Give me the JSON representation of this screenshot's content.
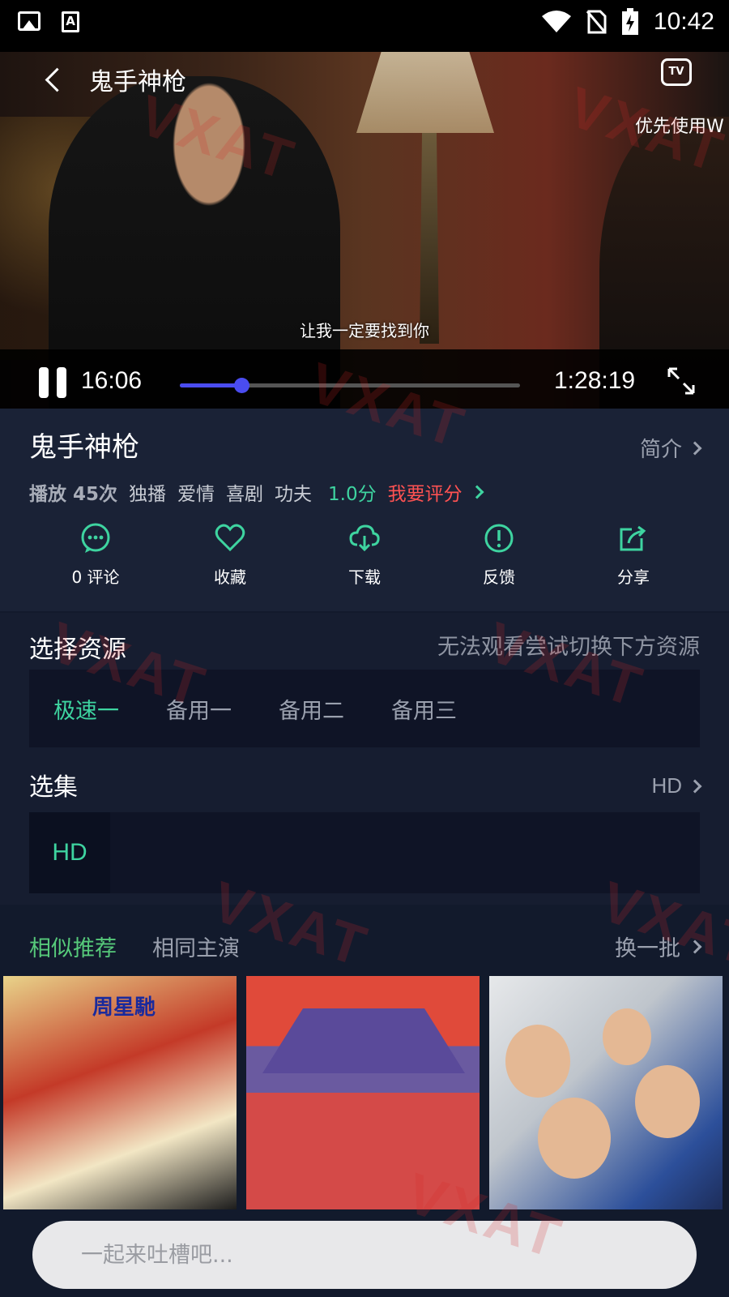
{
  "status_bar": {
    "time": "10:42"
  },
  "player": {
    "title": "鬼手神枪",
    "tv_hint": "优先使用W",
    "subtitle": "让我一定要找到你",
    "current_time": "16:06",
    "total_time": "1:28:19",
    "progress": 0.18
  },
  "info": {
    "title": "鬼手神枪",
    "intro_label": "简介",
    "play_count": "播放 45次",
    "tags": [
      "独播",
      "爱情",
      "喜剧",
      "功夫"
    ],
    "score": "1.0分",
    "rate_label": "我要评分",
    "actions": [
      {
        "icon": "comment-icon",
        "label": "0 评论"
      },
      {
        "icon": "heart-icon",
        "label": "收藏"
      },
      {
        "icon": "cloud-download-icon",
        "label": "下载"
      },
      {
        "icon": "alert-icon",
        "label": "反馈"
      },
      {
        "icon": "share-icon",
        "label": "分享"
      }
    ]
  },
  "source": {
    "title": "选择资源",
    "hint": "无法观看尝试切换下方资源",
    "tabs": [
      "极速一",
      "备用一",
      "备用二",
      "备用三"
    ],
    "active_tab": 0
  },
  "episodes": {
    "title": "选集",
    "quality_label": "HD",
    "items": [
      "HD"
    ]
  },
  "recommend": {
    "tabs": [
      "相似推荐",
      "相同主演"
    ],
    "refresh_label": "换一批",
    "posters": [
      {
        "title": "周星馳"
      },
      {
        "title": ""
      },
      {
        "title": ""
      }
    ]
  },
  "comment": {
    "placeholder": "一起来吐槽吧..."
  },
  "colors": {
    "accent_green": "#3ed4a0",
    "accent_red": "#ff5252",
    "progress_blue": "#4a4cf0",
    "background": "#131a2c"
  },
  "watermark": "VXAT"
}
